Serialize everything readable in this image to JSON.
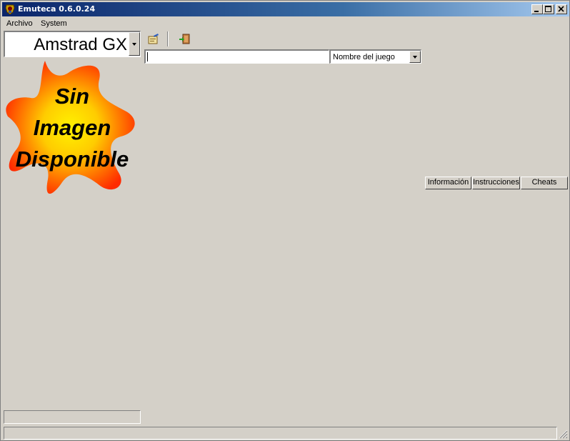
{
  "window": {
    "title": "Emuteca 0.6.0.24"
  },
  "menu": {
    "items": [
      "Archivo",
      "System"
    ]
  },
  "system_selector": {
    "value": "Amstrad GX"
  },
  "preview": {
    "line1": "Sin",
    "line2": "Imagen",
    "line3": "Disponible"
  },
  "search": {
    "value": "",
    "field": "Nombre del juego"
  },
  "tabs": {
    "info": "Información",
    "instructions": "Instrucciones",
    "cheats": "Cheats"
  },
  "statusbar": {
    "text": ""
  },
  "colors": {
    "title_start": "#0a246a",
    "title_end": "#a6caf0",
    "face": "#d4d0c8",
    "star_outer": "#ff2a00",
    "star_inner": "#ffee00"
  }
}
